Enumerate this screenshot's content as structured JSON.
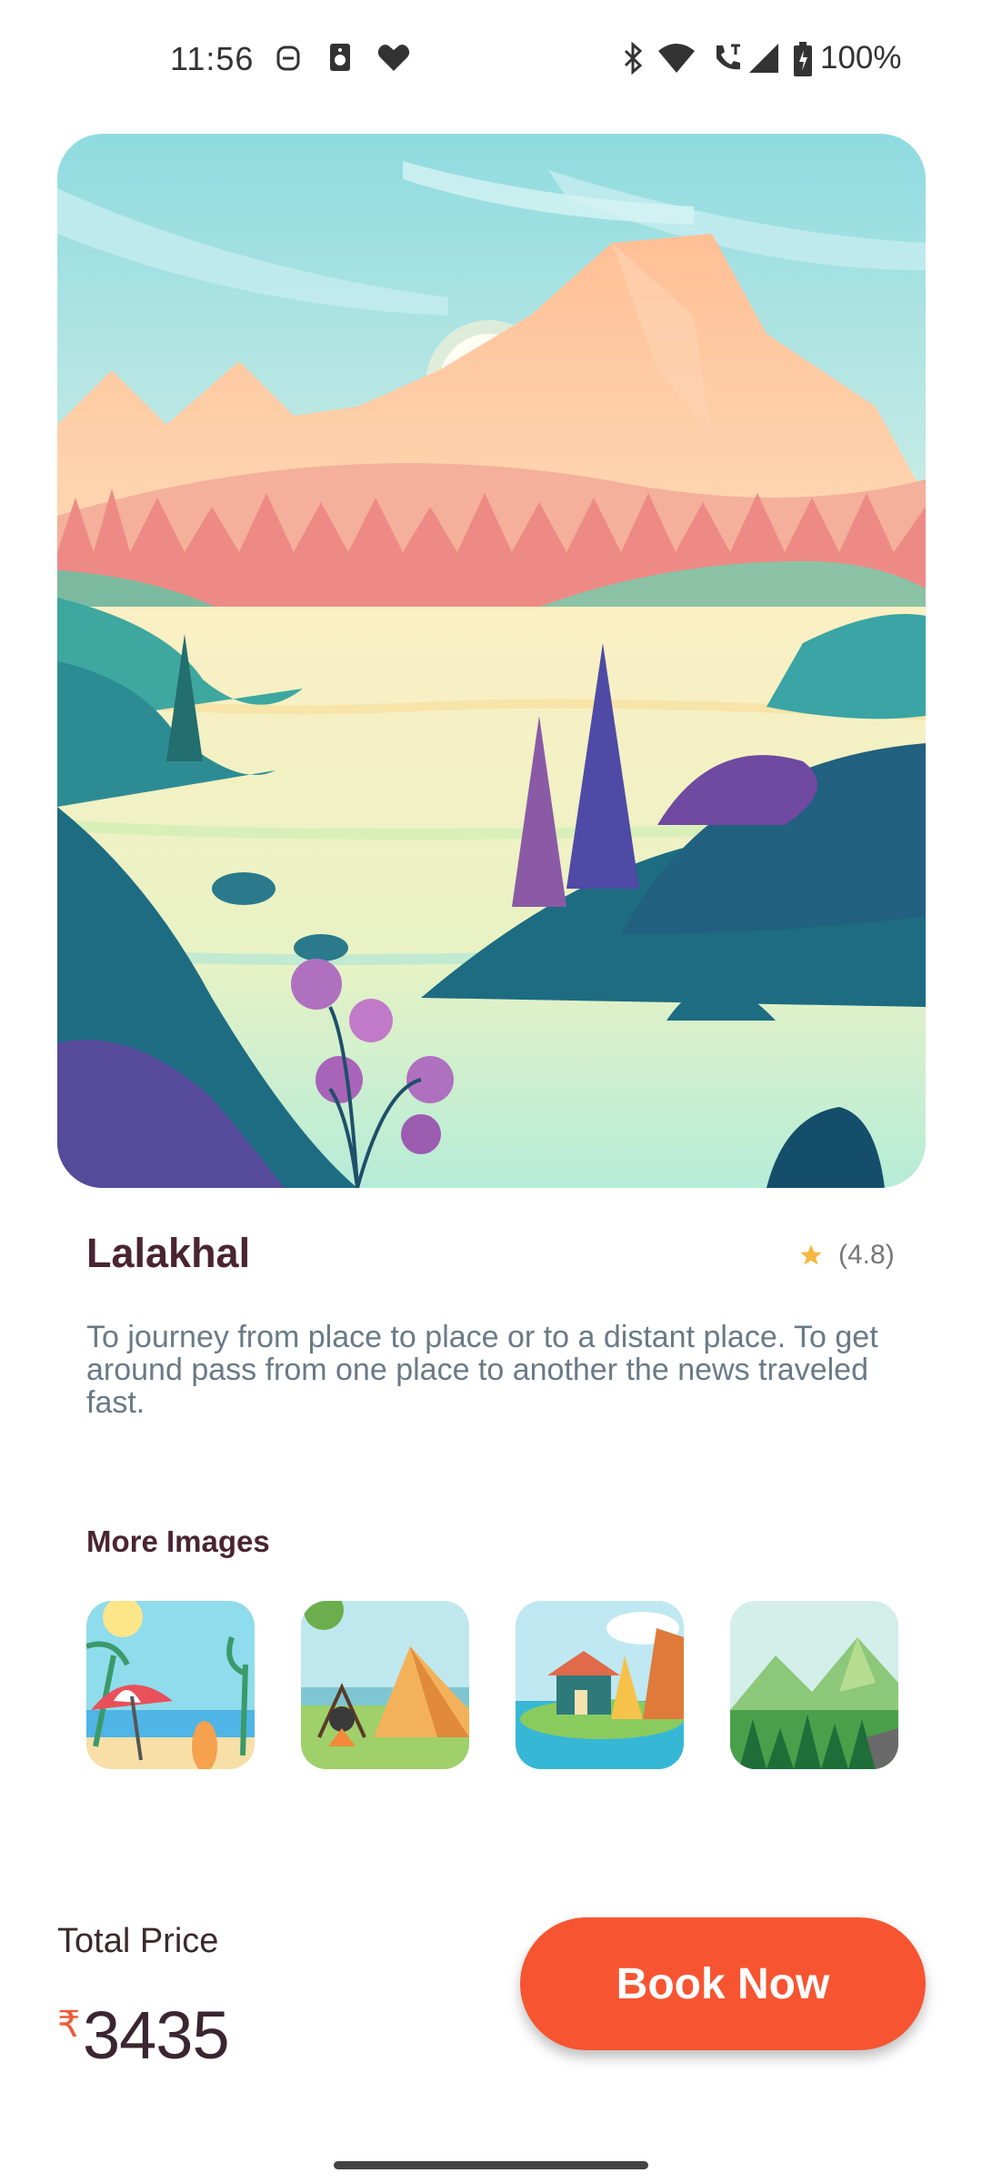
{
  "status_bar": {
    "time": "11:56",
    "battery_percent": "100%",
    "left_icons": [
      "notification-icon",
      "sim-icon",
      "heart-icon"
    ],
    "right_icons": [
      "bluetooth-icon",
      "wifi-icon",
      "call-icon",
      "signal-icon",
      "battery-icon"
    ]
  },
  "place": {
    "name": "Lalakhal",
    "rating": "(4.8)",
    "description": "To journey from place to place or to a distant place. To get around pass from one place to another the news traveled fast."
  },
  "more_images": {
    "heading": "More Images",
    "items": [
      "beach-thumbnail",
      "camping-thumbnail",
      "lake-house-thumbnail",
      "mountain-forest-thumbnail"
    ]
  },
  "booking": {
    "total_label": "Total Price",
    "currency": "₹",
    "amount": "3435",
    "button_label": "Book Now"
  },
  "colors": {
    "accent": "#f75532",
    "title": "#4a2531",
    "star": "#f5b942"
  }
}
